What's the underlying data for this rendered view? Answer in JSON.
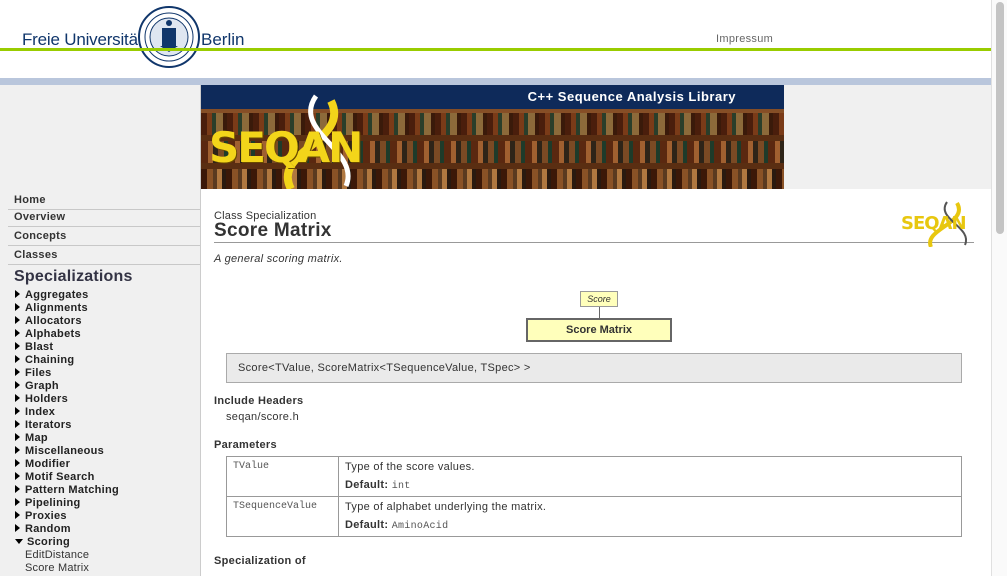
{
  "header": {
    "logo_left": "Freie Universität",
    "logo_right": "Berlin",
    "impressum": "Impressum"
  },
  "banner": {
    "title": "C++ Sequence Analysis Library",
    "logo_text": "SEQAN"
  },
  "sidebar": {
    "nav": [
      {
        "label": "Home"
      },
      {
        "label": "Overview"
      },
      {
        "label": "Concepts"
      },
      {
        "label": "Classes"
      }
    ],
    "specializations_heading": "Specializations",
    "items": [
      {
        "label": "Aggregates"
      },
      {
        "label": "Alignments"
      },
      {
        "label": "Allocators"
      },
      {
        "label": "Alphabets"
      },
      {
        "label": "Blast"
      },
      {
        "label": "Chaining"
      },
      {
        "label": "Files"
      },
      {
        "label": "Graph"
      },
      {
        "label": "Holders"
      },
      {
        "label": "Index"
      },
      {
        "label": "Iterators"
      },
      {
        "label": "Map"
      },
      {
        "label": "Miscellaneous"
      },
      {
        "label": "Modifier"
      },
      {
        "label": "Motif Search"
      },
      {
        "label": "Pattern Matching"
      },
      {
        "label": "Pipelining"
      },
      {
        "label": "Proxies"
      },
      {
        "label": "Random"
      },
      {
        "label": "Scoring"
      }
    ],
    "scoring_children": [
      {
        "label": "EditDistance"
      },
      {
        "label": "Score Matrix"
      }
    ]
  },
  "main": {
    "kind": "Class Specialization",
    "title": "Score Matrix",
    "summary": "A general scoring matrix.",
    "small_logo": "SEQAN",
    "diagram": {
      "base": "Score",
      "this": "Score Matrix"
    },
    "signature": "Score<TValue, ScoreMatrix<TSequenceValue, TSpec> >",
    "include_heading": "Include Headers",
    "include_file": "seqan/score.h",
    "params_heading": "Parameters",
    "params": [
      {
        "name": "TValue",
        "desc": "Type of the score values.",
        "default_label": "Default:",
        "default": "int"
      },
      {
        "name": "TSequenceValue",
        "desc": "Type of alphabet underlying the matrix.",
        "default_label": "Default:",
        "default": "AminoAcid"
      }
    ],
    "spec_of_heading": "Specialization of"
  },
  "colors": {
    "fu_blue": "#10366b",
    "fu_green": "#99cc00",
    "banner_navy": "#0e2a5a",
    "seqan_yellow": "#f3d51a",
    "diagram_fill": "#ffffbb"
  }
}
